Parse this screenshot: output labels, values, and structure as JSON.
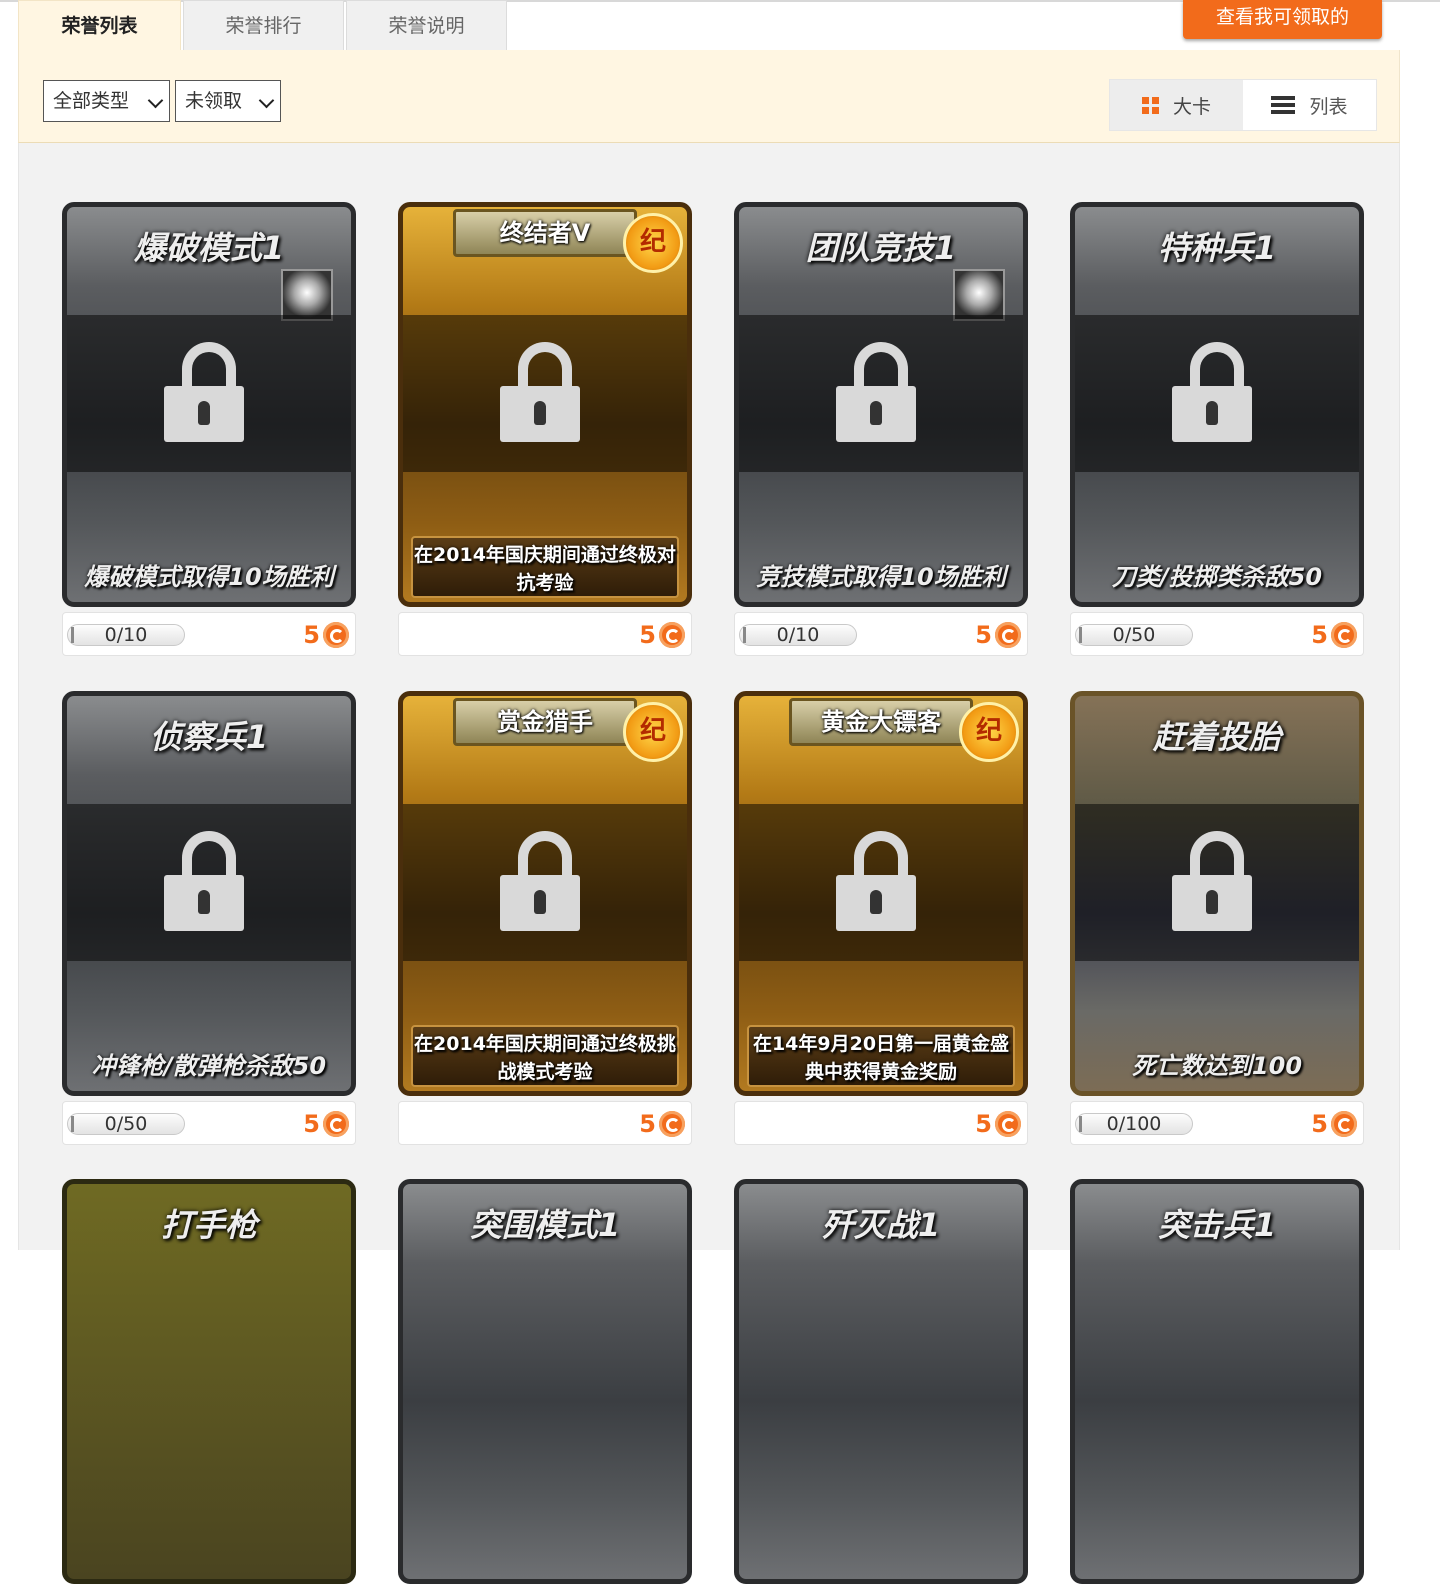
{
  "tabs": [
    {
      "label": "荣誉列表",
      "active": true
    },
    {
      "label": "荣誉排行",
      "active": false
    },
    {
      "label": "荣誉说明",
      "active": false
    }
  ],
  "claim_button": "查看我可领取的",
  "filters": {
    "type_select": "全部类型",
    "status_select": "未领取"
  },
  "view_toggle": {
    "card_label": "大卡",
    "list_label": "列表",
    "active": "card"
  },
  "colors": {
    "accent": "#f26b1b",
    "filter_bg": "#fff6e2",
    "content_bg": "#f2f2f2"
  },
  "cards": [
    {
      "title": "爆破模式1",
      "desc": "爆破模式取得10场胜利",
      "progress": "0/10",
      "reward": "5",
      "style": "dark",
      "icon": "skull-badge-icon",
      "locked": true
    },
    {
      "title": "终结者V",
      "desc": "在2014年国庆期间通过终极对抗考验",
      "progress": "",
      "reward": "5",
      "style": "gold",
      "medal": "纪",
      "locked": true
    },
    {
      "title": "团队竞技1",
      "desc": "竞技模式取得10场胜利",
      "progress": "0/10",
      "reward": "5",
      "style": "dark",
      "icon": "star-badge-icon",
      "locked": true
    },
    {
      "title": "特种兵1",
      "desc": "刀类/投掷类杀敌50",
      "progress": "0/50",
      "reward": "5",
      "style": "dark",
      "locked": true
    },
    {
      "title": "侦察兵1",
      "desc": "冲锋枪/散弹枪杀敌50",
      "progress": "0/50",
      "reward": "5",
      "style": "dark",
      "locked": true
    },
    {
      "title": "赏金猎手",
      "desc": "在2014年国庆期间通过终极挑战模式考验",
      "progress": "",
      "reward": "5",
      "style": "gold",
      "medal": "纪",
      "locked": true
    },
    {
      "title": "黄金大镖客",
      "desc": "在14年9月20日第一届黄金盛典中获得黄金奖励",
      "progress": "",
      "reward": "5",
      "style": "gold",
      "medal": "纪",
      "locked": true
    },
    {
      "title": "赶着投胎",
      "desc": "死亡数达到100",
      "progress": "0/100",
      "reward": "5",
      "style": "sepia",
      "locked": true
    },
    {
      "title": "打手枪",
      "style": "olive"
    },
    {
      "title": "突围模式1",
      "style": "dark"
    },
    {
      "title": "歼灭战1",
      "style": "dark"
    },
    {
      "title": "突击兵1",
      "style": "dark"
    }
  ]
}
